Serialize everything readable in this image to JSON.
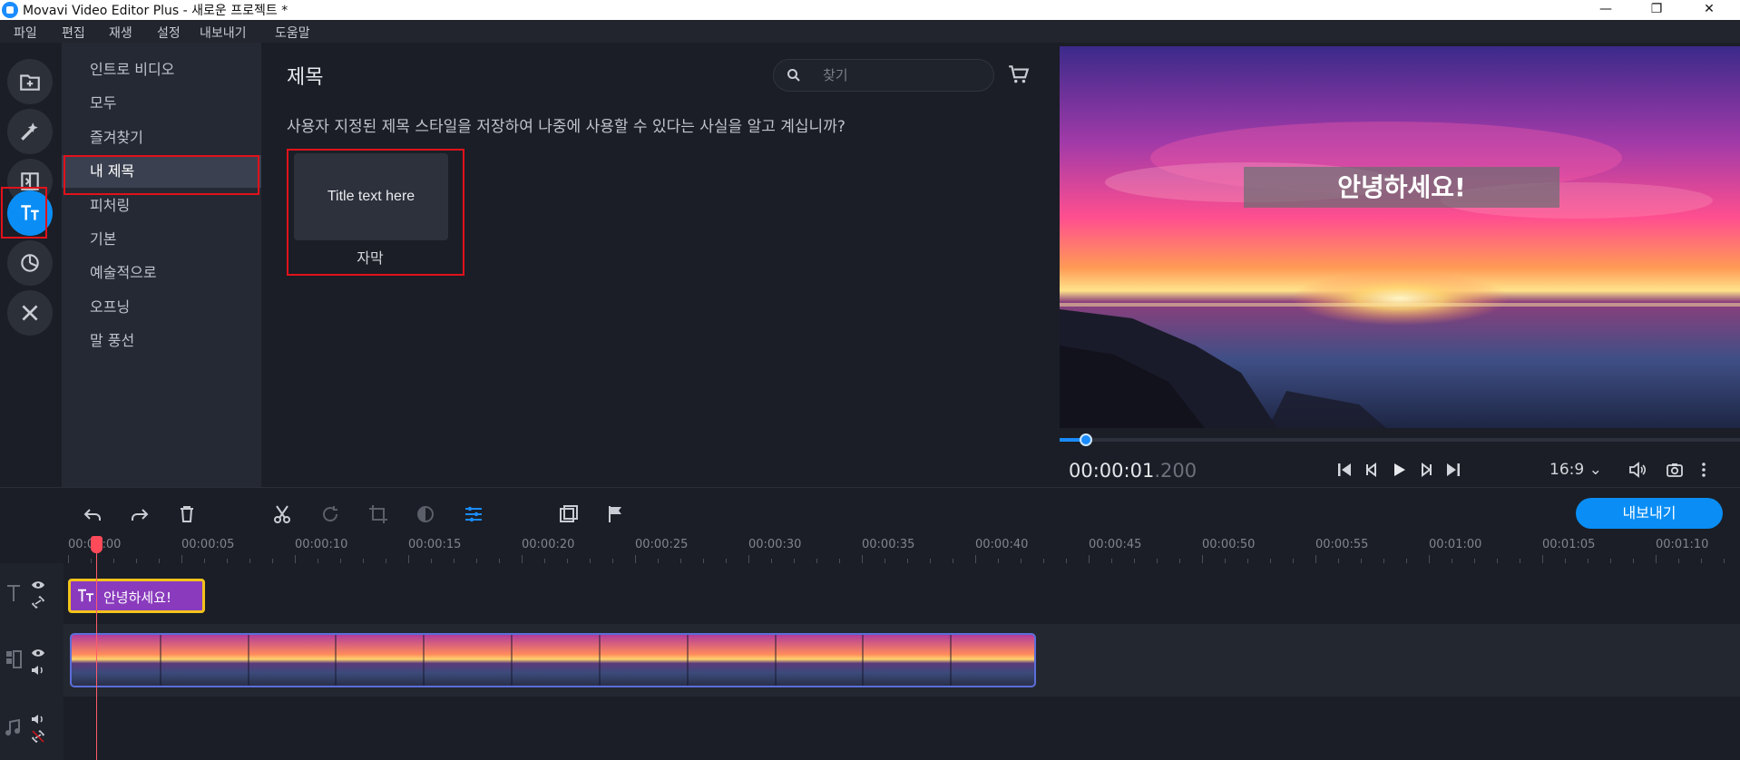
{
  "window": {
    "title": "Movavi Video Editor Plus - 새로운 프로젝트 *",
    "minimize": "—",
    "maximize": "❐",
    "close": "✕"
  },
  "menu": [
    "파일",
    "편집",
    "재생",
    "설정",
    "내보내기",
    "도움말"
  ],
  "rail": {
    "icons": [
      "import-icon",
      "magic-wand-icon",
      "transitions-icon",
      "titles-icon",
      "stickers-icon",
      "tools-icon"
    ],
    "active": "titles-icon"
  },
  "categories": {
    "items": [
      "인트로 비디오",
      "모두",
      "즐겨찾기",
      "내 제목",
      "피처링",
      "기본",
      "예술적으로",
      "오프닝",
      "말 풍선"
    ],
    "selected": "내 제목"
  },
  "content": {
    "title": "제목",
    "search_placeholder": "찾기",
    "hint": "사용자 지정된 제목 스타일을 저장하여 나중에 사용할 수 있다는 사실을 알고 계십니까?",
    "card": {
      "thumb_text": "Title text here",
      "label": "자막"
    }
  },
  "preview": {
    "overlay_text": "안녕하세요!",
    "timecode_main": "00:00:01",
    "timecode_ms": ".200",
    "aspect_ratio": "16:9 ⌄",
    "progress": 0.04
  },
  "toolbar": {
    "export_label": "내보내기",
    "icons": [
      "undo-icon",
      "redo-icon",
      "delete-icon",
      "cut-icon",
      "rotate-icon",
      "crop-icon",
      "color-adjust-icon",
      "clip-properties-icon",
      "overlay-icon",
      "marker-icon"
    ]
  },
  "timeline": {
    "ruler": [
      "00:00:00",
      "00:00:05",
      "00:00:10",
      "00:00:15",
      "00:00:20",
      "00:00:25",
      "00:00:30",
      "00:00:35",
      "00:00:40",
      "00:00:45",
      "00:00:50",
      "00:00:55",
      "00:01:00",
      "00:01:05",
      "00:01:10"
    ],
    "title_clip": "안녕하세요!",
    "video_clip_frames": 11
  },
  "colors": {
    "accent": "#0a8ef5",
    "highlight_border": "#e0121b",
    "title_clip": "#8a3bbd",
    "title_clip_border": "#f2c31b",
    "video_clip_border": "#5b6ed9",
    "playhead": "#ff4a5a"
  }
}
